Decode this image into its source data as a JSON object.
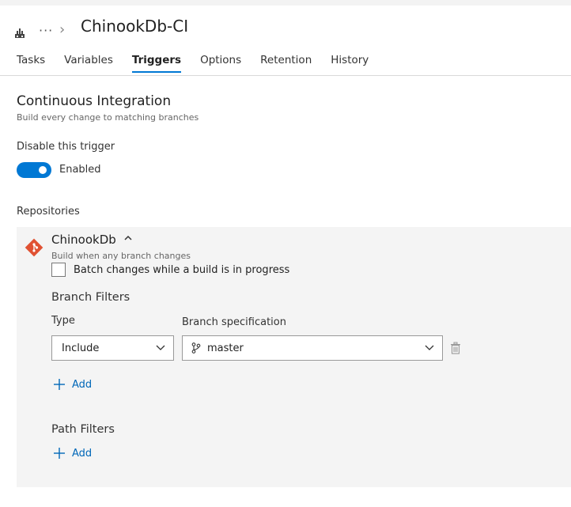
{
  "header": {
    "more_glyph": "···",
    "chevron_glyph": "›",
    "pipeline_title": "ChinookDb-CI",
    "icons": [
      "build-pipeline-icon",
      "chevron-right-icon"
    ]
  },
  "tabs": [
    {
      "label": "Tasks",
      "active": false
    },
    {
      "label": "Variables",
      "active": false
    },
    {
      "label": "Triggers",
      "active": true
    },
    {
      "label": "Options",
      "active": false
    },
    {
      "label": "Retention",
      "active": false
    },
    {
      "label": "History",
      "active": false
    }
  ],
  "ci": {
    "title": "Continuous Integration",
    "subtitle": "Build every change to matching branches",
    "disable_label": "Disable this trigger",
    "toggle_on": true,
    "toggle_text": "Enabled",
    "repositories_label": "Repositories"
  },
  "repo": {
    "name": "ChinookDb",
    "description": "Build when any branch changes",
    "batch_label": "Batch changes while a build is in progress",
    "batch_checked": false,
    "branch_filters_title": "Branch Filters",
    "type_label": "Type",
    "spec_label": "Branch specification",
    "type_value": "Include",
    "spec_value": "master",
    "add_label": "Add",
    "path_filters_title": "Path Filters",
    "path_add_label": "Add"
  },
  "colors": {
    "accent": "#0078d4",
    "link": "#0067b8",
    "git": "#e05132",
    "panel": "#f4f4f4"
  }
}
